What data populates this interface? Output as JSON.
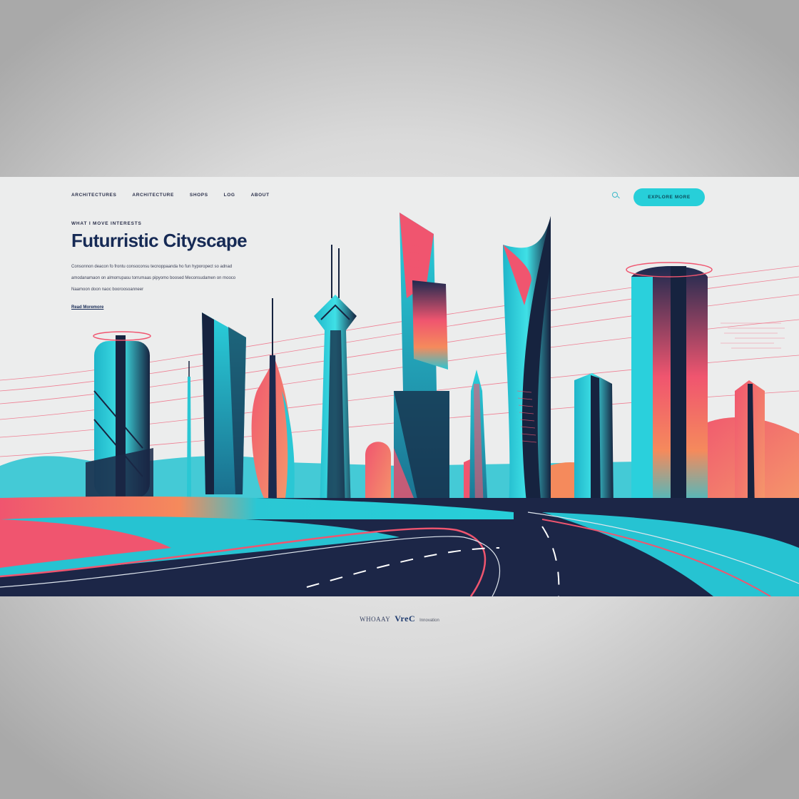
{
  "header": {
    "nav_items": [
      {
        "label": "Architectures"
      },
      {
        "label": "Architecture"
      },
      {
        "label": "Shops"
      },
      {
        "label": "Log"
      },
      {
        "label": "About"
      }
    ],
    "cta_label": "Explore More"
  },
  "hero": {
    "eyebrow": "What I Move Interests",
    "title": "Futurristic Cityscape",
    "body_lines": [
      "Consonnon deacon fo frontu consoconsu tecnoppaanda ho fun hyporopect so adnad",
      "amodanamaon on almorrupasu torrumaas pipyomo boosed Meconsudamen on mooco",
      "Naamoon doon naoc booroosoanneer"
    ],
    "read_more": "Read Moremore"
  },
  "footer": {
    "brand_prefix": "WHOAAY",
    "brand_name": "VreC",
    "tagline": "Innovation"
  },
  "palette": {
    "navy": "#162a55",
    "cyan": "#27cfd9",
    "coral": "#f0556f",
    "orange": "#f07a52",
    "page_bg": "#eceded"
  }
}
